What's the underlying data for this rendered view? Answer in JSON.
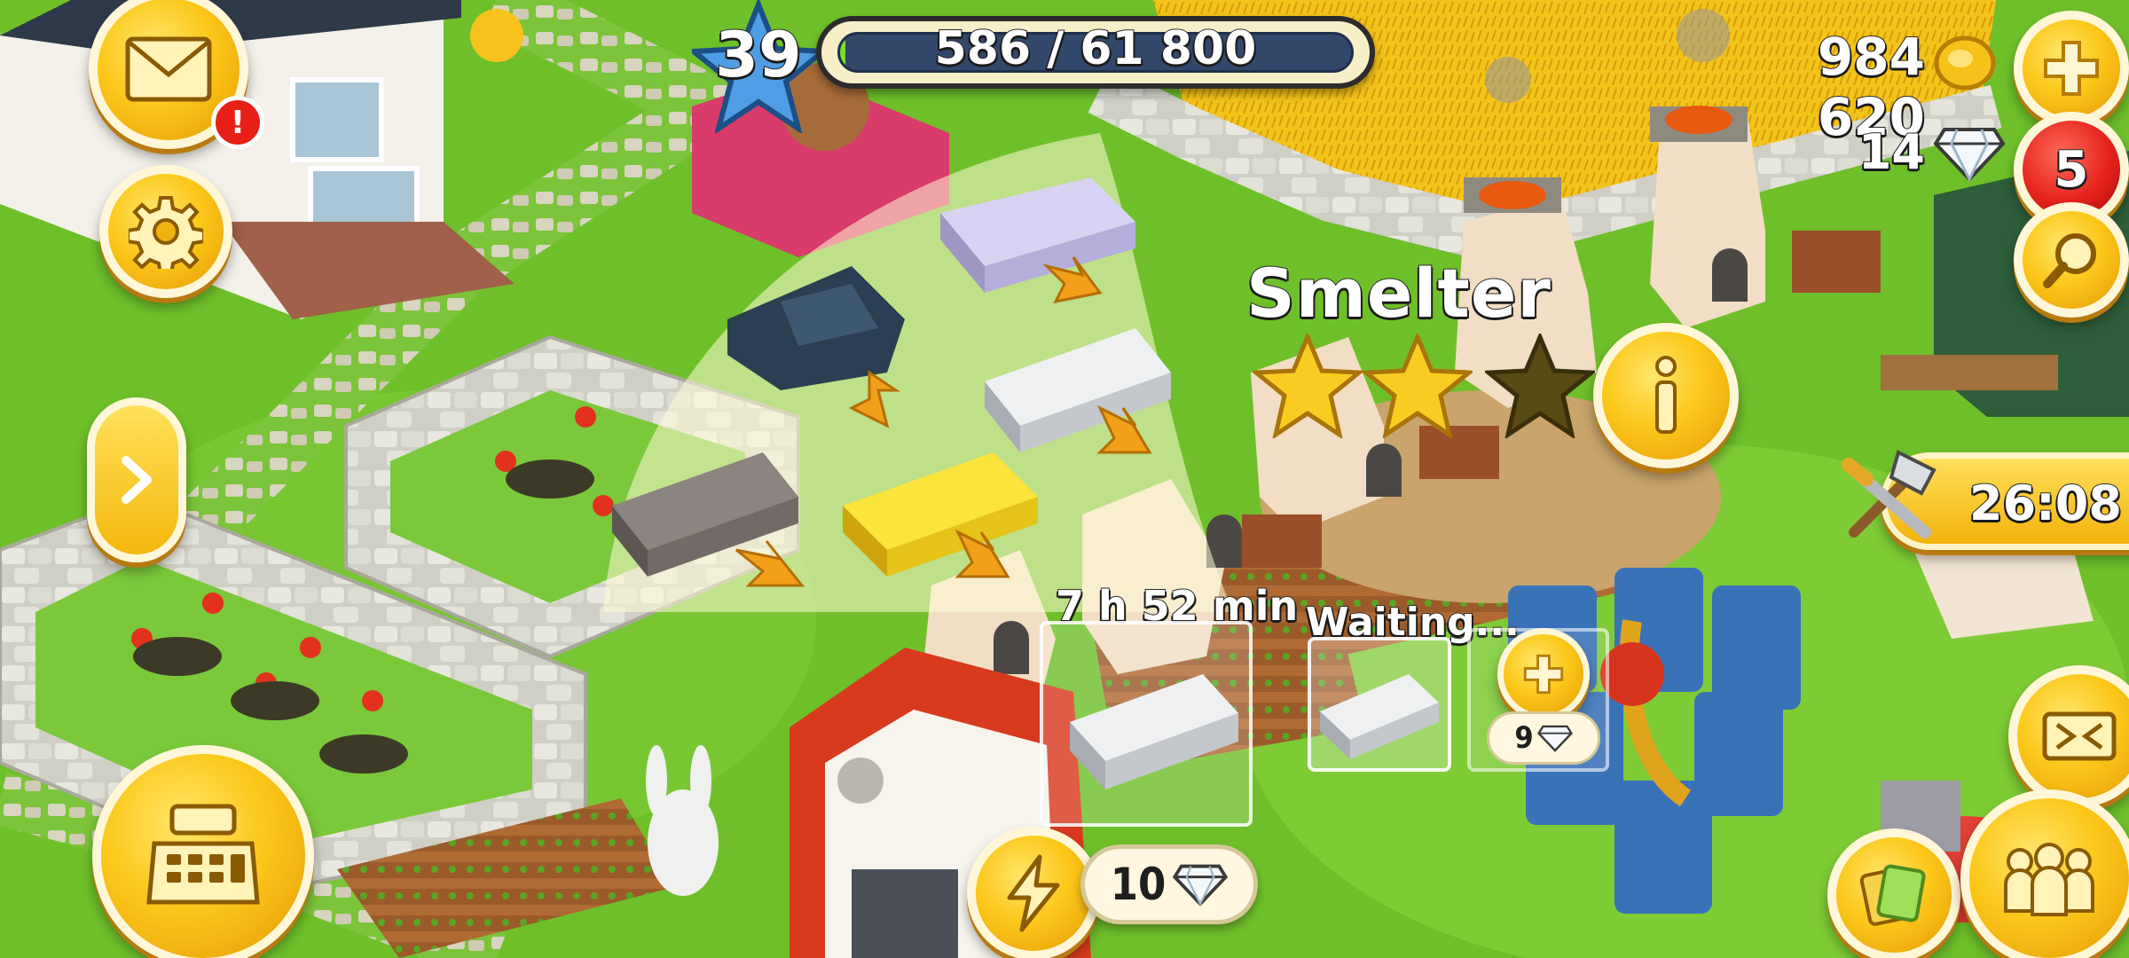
{
  "hud": {
    "level": "39",
    "xp_text": "586 / 61 800",
    "xp_progress": 0.0095,
    "coins": "984 620",
    "diamonds": "14",
    "notifications_count": "5",
    "mail_alert": "!"
  },
  "smelter": {
    "title": "Smelter",
    "stars_filled": 2,
    "stars_total": 3,
    "timer": "7 h 52 min",
    "waiting_label": "Waiting...",
    "add_slot_cost": "9",
    "speedup_cost": "10",
    "products": [
      "platinum-bar",
      "silver-bar",
      "gold-bar",
      "iron-bar",
      "coal"
    ]
  },
  "derby": {
    "timer": "26:08"
  },
  "colors": {
    "button_yellow": "#fcc81a",
    "button_red": "#e5231b",
    "xp_fill": "#7ce02a",
    "grass": "#6fbf2a"
  }
}
